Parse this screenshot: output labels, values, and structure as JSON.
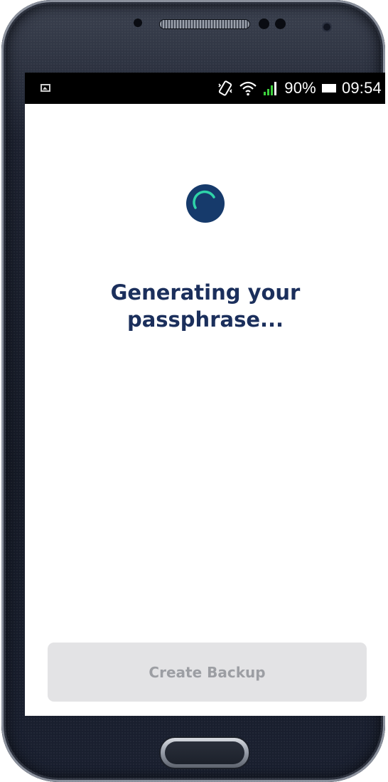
{
  "status_bar": {
    "battery_percent": "90%",
    "time": "09:54",
    "icons": [
      "gallery-notification-icon",
      "vibrate-icon",
      "wifi-icon",
      "signal-icon",
      "battery-icon"
    ]
  },
  "main": {
    "spinner_icon": "loading-spinner-icon",
    "title": "Generating your passphrase..."
  },
  "footer": {
    "create_backup_label": "Create Backup"
  },
  "colors": {
    "title": "#1b2f5c",
    "spinner_bg": "#163a6b",
    "spinner_arc": "#2fd3a8",
    "button_bg": "#e3e3e5",
    "button_text": "#9c9ea3",
    "status_bar_bg": "#000000"
  }
}
